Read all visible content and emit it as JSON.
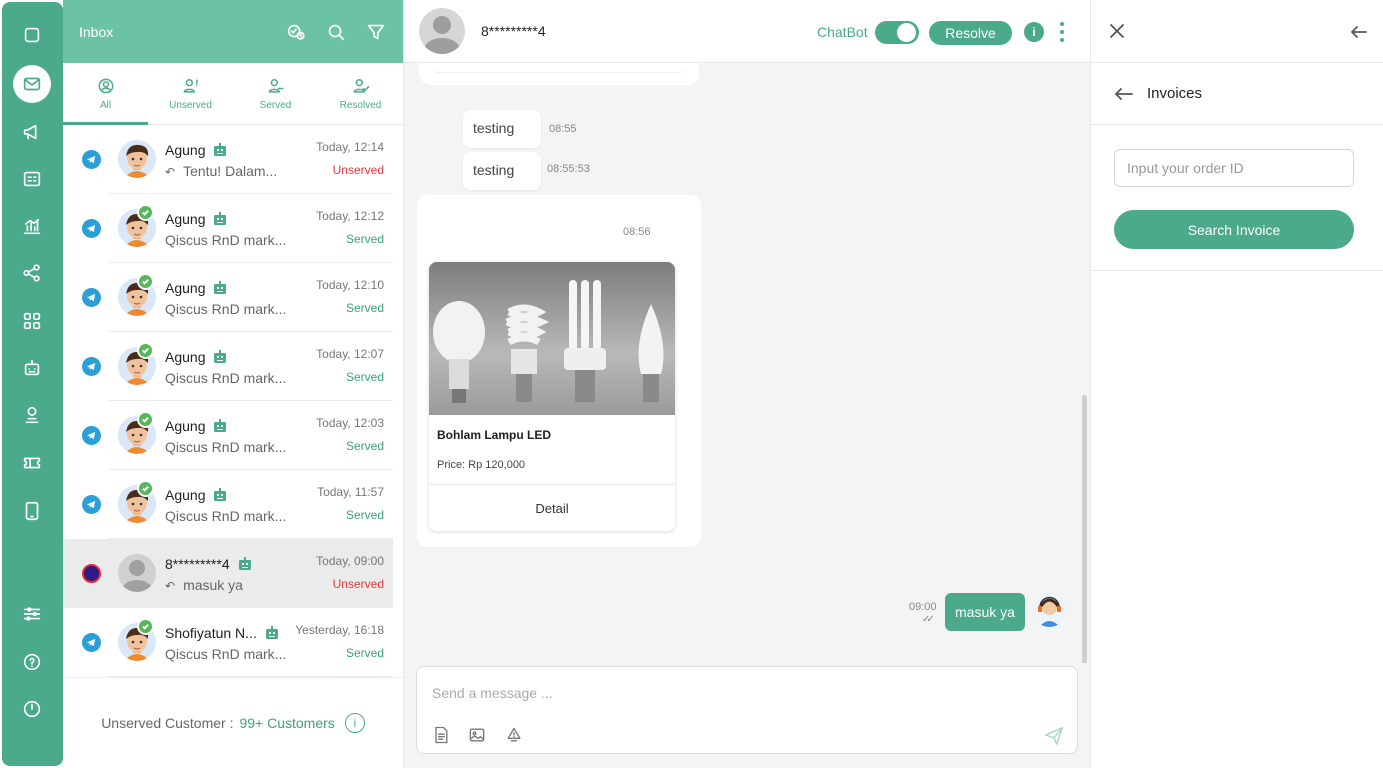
{
  "colors": {
    "primary": "#4aaa8b",
    "header_teal": "#6cc3a4",
    "unserved": "#e0393e",
    "served": "#3aa37c",
    "telegram": "#2a9fd8"
  },
  "nav": {
    "items": [
      {
        "name": "chat-icon",
        "active": false
      },
      {
        "name": "inbox-icon",
        "active": true
      },
      {
        "name": "megaphone-icon",
        "active": false
      },
      {
        "name": "contact-card-icon",
        "active": false
      },
      {
        "name": "analytics-icon",
        "active": false
      },
      {
        "name": "share-icon",
        "active": false
      },
      {
        "name": "apps-grid-icon",
        "active": false
      },
      {
        "name": "bot-icon",
        "active": false
      },
      {
        "name": "agent-icon",
        "active": false
      },
      {
        "name": "ticket-icon",
        "active": false
      },
      {
        "name": "mobile-icon",
        "active": false
      },
      {
        "name": "settings-sliders-icon",
        "active": false
      },
      {
        "name": "help-icon",
        "active": false
      },
      {
        "name": "power-icon",
        "active": false
      }
    ]
  },
  "inbox": {
    "title": "Inbox",
    "tabs": [
      {
        "label": "All",
        "icon": "user-circle-icon"
      },
      {
        "label": "Unserved",
        "icon": "user-alert-icon"
      },
      {
        "label": "Served",
        "icon": "user-served-icon"
      },
      {
        "label": "Resolved",
        "icon": "user-check-icon"
      }
    ],
    "conversations": [
      {
        "name": "Agung",
        "preview": "Tentu! Dalam...",
        "reply": true,
        "time": "Today, 12:14",
        "status": "Unserved",
        "channel": "telegram",
        "checked": false,
        "avatar": "cartoon"
      },
      {
        "name": "Agung",
        "preview": "Qiscus RnD mark...",
        "reply": false,
        "time": "Today, 12:12",
        "status": "Served",
        "channel": "telegram",
        "checked": true,
        "avatar": "cartoon"
      },
      {
        "name": "Agung",
        "preview": "Qiscus RnD mark...",
        "reply": false,
        "time": "Today, 12:10",
        "status": "Served",
        "channel": "telegram",
        "checked": true,
        "avatar": "cartoon"
      },
      {
        "name": "Agung",
        "preview": "Qiscus RnD mark...",
        "reply": false,
        "time": "Today, 12:07",
        "status": "Served",
        "channel": "telegram",
        "checked": true,
        "avatar": "cartoon"
      },
      {
        "name": "Agung",
        "preview": "Qiscus RnD mark...",
        "reply": false,
        "time": "Today, 12:03",
        "status": "Served",
        "channel": "telegram",
        "checked": true,
        "avatar": "cartoon"
      },
      {
        "name": "Agung",
        "preview": "Qiscus RnD mark...",
        "reply": false,
        "time": "Today, 11:57",
        "status": "Served",
        "channel": "telegram",
        "checked": true,
        "avatar": "cartoon"
      },
      {
        "name": "8*********4",
        "preview": "masuk ya",
        "reply": true,
        "time": "Today, 09:00",
        "status": "Unserved",
        "channel": "other",
        "checked": false,
        "avatar": "grey",
        "selected": true
      },
      {
        "name": "Shofiyatun N...",
        "preview": "Qiscus RnD mark...",
        "reply": false,
        "time": "Yesterday, 16:18",
        "status": "Served",
        "channel": "telegram",
        "checked": true,
        "avatar": "cartoon"
      }
    ],
    "footer": {
      "label": "Unserved Customer :",
      "count": "99+ Customers"
    }
  },
  "chat": {
    "contact_name": "8*********4",
    "chatbot_label": "ChatBot",
    "chatbot_on": true,
    "resolve_label": "Resolve",
    "messages": [
      {
        "text": "testing",
        "time": "08:55"
      },
      {
        "text": "testing",
        "time": "08:55:53"
      }
    ],
    "card_time": "08:56",
    "product": {
      "name": "Bohlam Lampu LED",
      "price": "Price: Rp 120,000",
      "button": "Detail"
    },
    "outgoing": {
      "text": "masuk ya",
      "time": "09:00"
    },
    "composer_placeholder": "Send a message ..."
  },
  "panel": {
    "section_title": "Invoices",
    "order_placeholder": "Input your order ID",
    "search_label": "Search Invoice"
  }
}
